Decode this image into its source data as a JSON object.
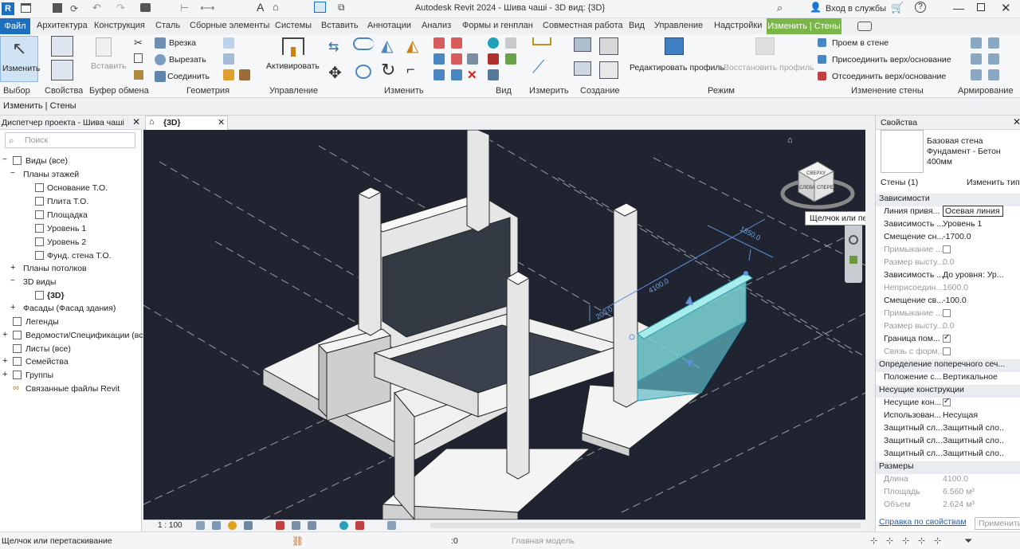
{
  "window": {
    "title": "Autodesk Revit 2024 - Шива чаші - 3D вид: {3D}",
    "signin": "Вход в службы",
    "app_badge": "R"
  },
  "tabs": [
    {
      "label": "Файл"
    },
    {
      "label": "Архитектура"
    },
    {
      "label": "Конструкция"
    },
    {
      "label": "Сталь"
    },
    {
      "label": "Сборные элементы"
    },
    {
      "label": "Системы"
    },
    {
      "label": "Вставить"
    },
    {
      "label": "Аннотации"
    },
    {
      "label": "Анализ"
    },
    {
      "label": "Формы и генплан"
    },
    {
      "label": "Совместная работа"
    },
    {
      "label": "Вид"
    },
    {
      "label": "Управление"
    },
    {
      "label": "Надстройки"
    },
    {
      "label": "Изменить | Стены"
    }
  ],
  "ribbon": {
    "modify": "Изменить",
    "properties": "Свойства",
    "paste": "Вставить",
    "cut": "Врезка",
    "cutout": "Вырезать",
    "join": "Соединить",
    "activate": "Активировать",
    "edit_profile": "Редактировать профиль",
    "reset_profile": "Восстановить профиль",
    "wall_opening": "Проем в стене",
    "attach": "Присоединить верх/основание",
    "detach": "Отсоединить верх/основание",
    "panels": {
      "select": "Выбор",
      "props": "Свойства",
      "clipboard": "Буфер обмена",
      "geometry": "Геометрия",
      "control": "Управление",
      "modify": "Изменить",
      "view": "Вид",
      "measure": "Измерить",
      "create": "Создание",
      "mode": "Режим",
      "wall_modify": "Изменение стены",
      "rebar": "Армирование"
    }
  },
  "options_bar": {
    "context": "Изменить | Стены"
  },
  "browser": {
    "title": "Диспетчер проекта - Шива чаші",
    "search_placeholder": "Поиск",
    "items": [
      "Виды (все)",
      "Планы этажей",
      "Основание Т.О.",
      "Плита Т.О.",
      "Площадка",
      "Уровень 1",
      "Уровень 2",
      "Фунд. стена Т.О.",
      "Планы потолков",
      "3D виды",
      "{3D}",
      "Фасады (Фасад здания)",
      "Легенды",
      "Ведомости/Спецификации (все",
      "Листы (все)",
      "Семейства",
      "Группы",
      "Связанные файлы Revit"
    ]
  },
  "view": {
    "tab_label": "{3D}",
    "scale": "1 : 100",
    "tooltip": "Щелчок или перетаскивание",
    "dim1": "1850.0",
    "dim2": "4100.0",
    "dim3": "200.0",
    "cube_top": "СВЕРХУ",
    "cube_left": "СЛЕВА",
    "cube_front": "СПЕРЕДИ"
  },
  "properties": {
    "title": "Свойства",
    "type_line1": "Базовая стена",
    "type_line2": "Фундамент - Бетон",
    "type_line3": "400мм",
    "filter": "Стены (1)",
    "edit_type": "Изменить тип",
    "rows": [
      {
        "k": "Зависимости",
        "v": "",
        "sec": true
      },
      {
        "k": "Линия привя...",
        "v": "Осевая линия"
      },
      {
        "k": "Зависимость ...",
        "v": "Уровень 1"
      },
      {
        "k": "Смещение сн...",
        "v": "-1700.0"
      },
      {
        "k": "Примыкание ...",
        "v": "",
        "grey": true,
        "cb": "off"
      },
      {
        "k": "Размер высту...",
        "v": "0.0",
        "grey": true
      },
      {
        "k": "Зависимость ...",
        "v": "До уровня: Ур..."
      },
      {
        "k": "Неприсоедин...",
        "v": "1600.0",
        "grey": true
      },
      {
        "k": "Смещение св...",
        "v": "-100.0"
      },
      {
        "k": "Примыкание ...",
        "v": "",
        "grey": true,
        "cb": "off"
      },
      {
        "k": "Размер высту...",
        "v": "0.0",
        "grey": true
      },
      {
        "k": "Граница пом...",
        "v": "",
        "cb": "on"
      },
      {
        "k": "Связь с форм...",
        "v": "",
        "grey": true,
        "cb": "off"
      },
      {
        "k": "Определение поперечного сеч...",
        "v": "",
        "sec": true
      },
      {
        "k": "Положение с...",
        "v": "Вертикальное"
      },
      {
        "k": "Несущие конструкции",
        "v": "",
        "sec": true
      },
      {
        "k": "Несущие кон...",
        "v": "",
        "cb": "on"
      },
      {
        "k": "Использован...",
        "v": "Несущая"
      },
      {
        "k": "Защитный сл...",
        "v": "Защитный сло..."
      },
      {
        "k": "Защитный сл...",
        "v": "Защитный сло..."
      },
      {
        "k": "Защитный сл...",
        "v": "Защитный сло..."
      },
      {
        "k": "Размеры",
        "v": "",
        "sec": true
      },
      {
        "k": "Длина",
        "v": "4100.0",
        "grey": true
      },
      {
        "k": "Площадь",
        "v": "6.560 м²",
        "grey": true
      },
      {
        "k": "Объем",
        "v": "2.624 м³",
        "grey": true
      }
    ],
    "help_link": "Справка по свойствам",
    "apply": "Применить"
  },
  "status": {
    "text": "Щелчок или перетаскивание",
    "model": "Главная модель",
    "count": ":0"
  },
  "colors": {
    "accent": "#1f6fbf",
    "active_tab": "#7ab648",
    "selection": "#7fd6d6",
    "canvas": "#1f2430"
  }
}
